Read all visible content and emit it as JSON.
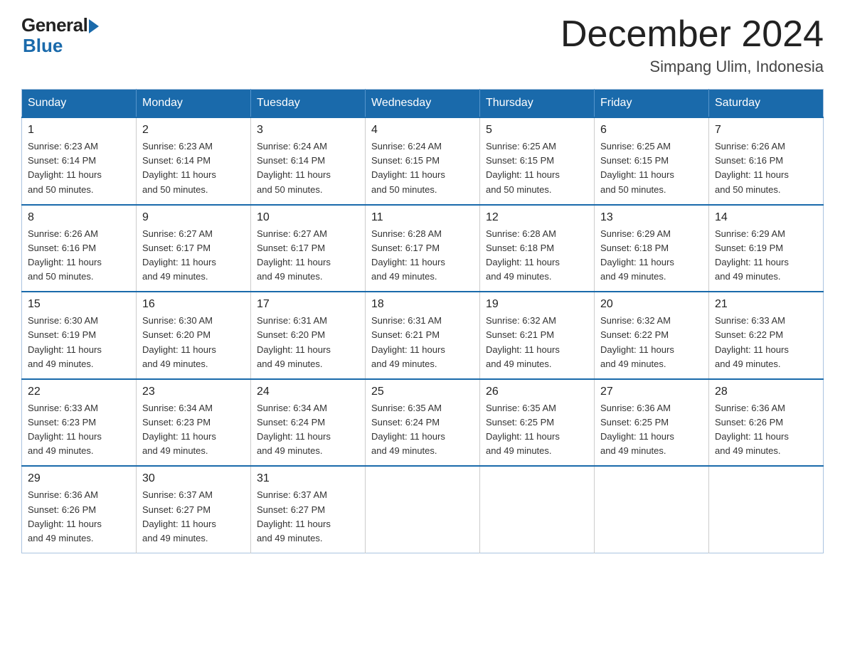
{
  "header": {
    "logo_general": "General",
    "logo_blue": "Blue",
    "month_title": "December 2024",
    "location": "Simpang Ulim, Indonesia"
  },
  "days_of_week": [
    "Sunday",
    "Monday",
    "Tuesday",
    "Wednesday",
    "Thursday",
    "Friday",
    "Saturday"
  ],
  "weeks": [
    [
      {
        "day": "1",
        "sunrise": "6:23 AM",
        "sunset": "6:14 PM",
        "daylight": "11 hours and 50 minutes."
      },
      {
        "day": "2",
        "sunrise": "6:23 AM",
        "sunset": "6:14 PM",
        "daylight": "11 hours and 50 minutes."
      },
      {
        "day": "3",
        "sunrise": "6:24 AM",
        "sunset": "6:14 PM",
        "daylight": "11 hours and 50 minutes."
      },
      {
        "day": "4",
        "sunrise": "6:24 AM",
        "sunset": "6:15 PM",
        "daylight": "11 hours and 50 minutes."
      },
      {
        "day": "5",
        "sunrise": "6:25 AM",
        "sunset": "6:15 PM",
        "daylight": "11 hours and 50 minutes."
      },
      {
        "day": "6",
        "sunrise": "6:25 AM",
        "sunset": "6:15 PM",
        "daylight": "11 hours and 50 minutes."
      },
      {
        "day": "7",
        "sunrise": "6:26 AM",
        "sunset": "6:16 PM",
        "daylight": "11 hours and 50 minutes."
      }
    ],
    [
      {
        "day": "8",
        "sunrise": "6:26 AM",
        "sunset": "6:16 PM",
        "daylight": "11 hours and 50 minutes."
      },
      {
        "day": "9",
        "sunrise": "6:27 AM",
        "sunset": "6:17 PM",
        "daylight": "11 hours and 49 minutes."
      },
      {
        "day": "10",
        "sunrise": "6:27 AM",
        "sunset": "6:17 PM",
        "daylight": "11 hours and 49 minutes."
      },
      {
        "day": "11",
        "sunrise": "6:28 AM",
        "sunset": "6:17 PM",
        "daylight": "11 hours and 49 minutes."
      },
      {
        "day": "12",
        "sunrise": "6:28 AM",
        "sunset": "6:18 PM",
        "daylight": "11 hours and 49 minutes."
      },
      {
        "day": "13",
        "sunrise": "6:29 AM",
        "sunset": "6:18 PM",
        "daylight": "11 hours and 49 minutes."
      },
      {
        "day": "14",
        "sunrise": "6:29 AM",
        "sunset": "6:19 PM",
        "daylight": "11 hours and 49 minutes."
      }
    ],
    [
      {
        "day": "15",
        "sunrise": "6:30 AM",
        "sunset": "6:19 PM",
        "daylight": "11 hours and 49 minutes."
      },
      {
        "day": "16",
        "sunrise": "6:30 AM",
        "sunset": "6:20 PM",
        "daylight": "11 hours and 49 minutes."
      },
      {
        "day": "17",
        "sunrise": "6:31 AM",
        "sunset": "6:20 PM",
        "daylight": "11 hours and 49 minutes."
      },
      {
        "day": "18",
        "sunrise": "6:31 AM",
        "sunset": "6:21 PM",
        "daylight": "11 hours and 49 minutes."
      },
      {
        "day": "19",
        "sunrise": "6:32 AM",
        "sunset": "6:21 PM",
        "daylight": "11 hours and 49 minutes."
      },
      {
        "day": "20",
        "sunrise": "6:32 AM",
        "sunset": "6:22 PM",
        "daylight": "11 hours and 49 minutes."
      },
      {
        "day": "21",
        "sunrise": "6:33 AM",
        "sunset": "6:22 PM",
        "daylight": "11 hours and 49 minutes."
      }
    ],
    [
      {
        "day": "22",
        "sunrise": "6:33 AM",
        "sunset": "6:23 PM",
        "daylight": "11 hours and 49 minutes."
      },
      {
        "day": "23",
        "sunrise": "6:34 AM",
        "sunset": "6:23 PM",
        "daylight": "11 hours and 49 minutes."
      },
      {
        "day": "24",
        "sunrise": "6:34 AM",
        "sunset": "6:24 PM",
        "daylight": "11 hours and 49 minutes."
      },
      {
        "day": "25",
        "sunrise": "6:35 AM",
        "sunset": "6:24 PM",
        "daylight": "11 hours and 49 minutes."
      },
      {
        "day": "26",
        "sunrise": "6:35 AM",
        "sunset": "6:25 PM",
        "daylight": "11 hours and 49 minutes."
      },
      {
        "day": "27",
        "sunrise": "6:36 AM",
        "sunset": "6:25 PM",
        "daylight": "11 hours and 49 minutes."
      },
      {
        "day": "28",
        "sunrise": "6:36 AM",
        "sunset": "6:26 PM",
        "daylight": "11 hours and 49 minutes."
      }
    ],
    [
      {
        "day": "29",
        "sunrise": "6:36 AM",
        "sunset": "6:26 PM",
        "daylight": "11 hours and 49 minutes."
      },
      {
        "day": "30",
        "sunrise": "6:37 AM",
        "sunset": "6:27 PM",
        "daylight": "11 hours and 49 minutes."
      },
      {
        "day": "31",
        "sunrise": "6:37 AM",
        "sunset": "6:27 PM",
        "daylight": "11 hours and 49 minutes."
      },
      null,
      null,
      null,
      null
    ]
  ],
  "labels": {
    "sunrise": "Sunrise:",
    "sunset": "Sunset:",
    "daylight": "Daylight:"
  }
}
